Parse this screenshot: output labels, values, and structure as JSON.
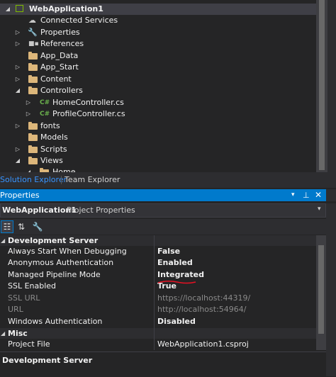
{
  "solution_explorer": {
    "project": "WebApplication1",
    "items": [
      {
        "label": "Connected Services"
      },
      {
        "label": "Properties"
      },
      {
        "label": "References"
      },
      {
        "label": "App_Data"
      },
      {
        "label": "App_Start"
      },
      {
        "label": "Content"
      },
      {
        "label": "Controllers"
      },
      {
        "label": "HomeController.cs"
      },
      {
        "label": "ProfileController.cs"
      },
      {
        "label": "fonts"
      },
      {
        "label": "Models"
      },
      {
        "label": "Scripts"
      },
      {
        "label": "Views"
      },
      {
        "label": "Home"
      }
    ]
  },
  "tabs": {
    "solution_explorer": "Solution Explorer",
    "team_explorer": "Team Explorer"
  },
  "properties": {
    "title": "Properties",
    "object_name": "WebApplication1",
    "object_type": "Project Properties",
    "categories": [
      {
        "name": "Development Server",
        "rows": [
          {
            "name": "Always Start When Debugging",
            "value": "False"
          },
          {
            "name": "Anonymous Authentication",
            "value": "Enabled"
          },
          {
            "name": "Managed Pipeline Mode",
            "value": "Integrated"
          },
          {
            "name": "SSL Enabled",
            "value": "True"
          },
          {
            "name": "SSL URL",
            "value": "https://localhost:44319/"
          },
          {
            "name": "URL",
            "value": "http://localhost:54964/"
          },
          {
            "name": "Windows Authentication",
            "value": "Disabled"
          }
        ]
      },
      {
        "name": "Misc",
        "rows": [
          {
            "name": "Project File",
            "value": "WebApplication1.csproj"
          }
        ]
      }
    ],
    "description_title": "Development Server"
  },
  "colors": {
    "accent": "#007acc",
    "annotation": "#e81123",
    "folder": "#dcb67a",
    "csharp": "#6ab04c"
  }
}
